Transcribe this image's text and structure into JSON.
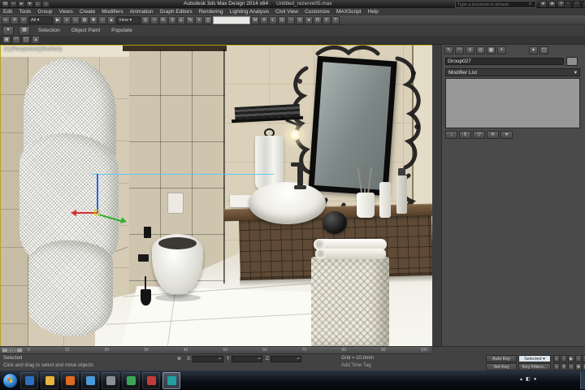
{
  "colors": {
    "viewport_active_border": "#b9a41e",
    "gizmo_x_axis": "#d83030",
    "gizmo_y_axis": "#2faf2f",
    "gizmo_z_axis": "#2e66d8",
    "selection_line": "#5ec6f0"
  },
  "title_bar": {
    "quick_access": [
      {
        "name": "max-logo-icon",
        "glyph": "M"
      },
      {
        "name": "new-file-icon",
        "glyph": "▫"
      },
      {
        "name": "open-file-icon",
        "glyph": "▸"
      },
      {
        "name": "save-file-icon",
        "glyph": "▾"
      },
      {
        "name": "undo-icon",
        "glyph": "←"
      },
      {
        "name": "redo-icon",
        "glyph": "→"
      }
    ],
    "app_title": "Autodesk 3ds Max Design 2014 x64",
    "file_name": "Untitled_rezerve05.max",
    "search_placeholder": "Type a keyword or phrase",
    "info_icons": [
      {
        "name": "search-go-icon",
        "glyph": "▾"
      },
      {
        "name": "communication-center-icon",
        "glyph": "★"
      },
      {
        "name": "help-icon",
        "glyph": "?"
      }
    ],
    "window_controls": [
      {
        "name": "minimize-button",
        "glyph": "–"
      },
      {
        "name": "maximize-button",
        "glyph": "□"
      },
      {
        "name": "close-button",
        "glyph": "✕"
      }
    ]
  },
  "menu_bar": {
    "items": [
      "Edit",
      "Tools",
      "Group",
      "Views",
      "Create",
      "Modifiers",
      "Animation",
      "Graph Editors",
      "Rendering",
      "Lighting Analysis",
      "Civil View",
      "Customize",
      "MAXScript",
      "Help"
    ]
  },
  "toolbar": {
    "items": [
      {
        "name": "select-and-link-icon",
        "cls": "tbi",
        "glyph": "∞"
      },
      {
        "name": "unlink-selection-icon",
        "cls": "tbi",
        "glyph": "≠"
      },
      {
        "name": "bind-to-space-warp-icon",
        "cls": "tbi",
        "glyph": "≈"
      },
      {
        "name": "selection-filter-dropdown",
        "cls": "tbdd",
        "glyph": "All ▾"
      },
      {
        "name": "select-object-icon",
        "cls": "tbi",
        "glyph": "▶"
      },
      {
        "name": "select-by-name-icon",
        "cls": "tbi",
        "glyph": "≡"
      },
      {
        "name": "rectangular-selection-region-icon",
        "cls": "tbi",
        "glyph": "□"
      },
      {
        "name": "window-crossing-icon",
        "cls": "tbi",
        "glyph": "⊠"
      },
      {
        "name": "select-and-move-icon",
        "cls": "tbi",
        "glyph": "✚"
      },
      {
        "name": "select-and-rotate-icon",
        "cls": "tbi",
        "glyph": "○"
      },
      {
        "name": "select-and-scale-icon",
        "cls": "tbi",
        "glyph": "▲"
      },
      {
        "name": "reference-coordinate-system-dropdown",
        "cls": "tbdd",
        "glyph": "View ▾"
      },
      {
        "name": "use-pivot-point-center-icon",
        "cls": "tbi",
        "glyph": "◎"
      },
      {
        "name": "select-and-manipulate-icon",
        "cls": "tbi",
        "glyph": "+"
      },
      {
        "name": "keyboard-shortcut-override-icon",
        "cls": "tbi",
        "glyph": "K"
      },
      {
        "name": "snaps-toggle-icon",
        "cls": "tbi",
        "glyph": "3"
      },
      {
        "name": "angle-snap-icon",
        "cls": "tbi",
        "glyph": "∠"
      },
      {
        "name": "percent-snap-icon",
        "cls": "tbi",
        "glyph": "%"
      },
      {
        "name": "spinner-snap-icon",
        "cls": "tbi",
        "glyph": "±"
      },
      {
        "name": "edit-named-selection-sets-icon",
        "cls": "tbi",
        "glyph": "{}"
      },
      {
        "name": "named-selection-sets-field",
        "cls": "tbbox",
        "glyph": ""
      },
      {
        "name": "mirror-icon",
        "cls": "tbi",
        "glyph": "M"
      },
      {
        "name": "align-icon",
        "cls": "tbi",
        "glyph": "#"
      },
      {
        "name": "layer-manager-icon",
        "cls": "tbi",
        "glyph": "L"
      },
      {
        "name": "graphite-ribbon-toggle-icon",
        "cls": "tbi",
        "glyph": "G"
      },
      {
        "name": "curve-editor-icon",
        "cls": "tbi",
        "glyph": "~"
      },
      {
        "name": "schematic-view-icon",
        "cls": "tbi",
        "glyph": "S"
      },
      {
        "name": "material-editor-icon",
        "cls": "tbi",
        "glyph": "●"
      },
      {
        "name": "render-setup-icon",
        "cls": "tbi",
        "glyph": "R"
      },
      {
        "name": "rendered-frame-window-icon",
        "cls": "tbi",
        "glyph": "F"
      },
      {
        "name": "render-production-icon",
        "cls": "tbi",
        "glyph": "T"
      }
    ]
  },
  "ribbon": {
    "tabs": [
      "Selection",
      "Object Paint",
      "Populate"
    ],
    "sub_tools": [
      {
        "name": "ribbon-polymodeling-icon",
        "glyph": "▦"
      },
      {
        "name": "ribbon-freeform-icon",
        "glyph": "◠"
      },
      {
        "name": "ribbon-selection-tool-icon",
        "glyph": "▢"
      },
      {
        "name": "ribbon-minimize-icon",
        "glyph": "▴"
      }
    ]
  },
  "viewport": {
    "label": "[+] [Perspective] [Realistic]"
  },
  "command_panel": {
    "tabs": [
      {
        "name": "create-tab-icon",
        "cls": "cpt",
        "glyph": "↖"
      },
      {
        "name": "modify-tab-icon",
        "cls": "cpt",
        "glyph": "◠"
      },
      {
        "name": "hierarchy-tab-icon",
        "cls": "cpt",
        "glyph": "≡"
      },
      {
        "name": "motion-tab-icon",
        "cls": "cpt",
        "glyph": "◎"
      },
      {
        "name": "display-tab-icon",
        "cls": "cpt",
        "glyph": "▦"
      },
      {
        "name": "utilities-tab-icon",
        "cls": "cpt",
        "glyph": "+"
      },
      {
        "name": "panel-arrow-icon",
        "cls": "cpt push",
        "glyph": "▾"
      },
      {
        "name": "panel-page-icon",
        "cls": "cpt",
        "glyph": "▢"
      }
    ],
    "object_name": "Group027",
    "object_color_swatch": "#8f8f8f",
    "modifier_list_label": "Modifier List",
    "stack_buttons": [
      {
        "name": "pin-stack-icon",
        "glyph": "↓"
      },
      {
        "name": "show-end-result-icon",
        "glyph": "‖"
      },
      {
        "name": "make-unique-icon",
        "glyph": "▽"
      },
      {
        "name": "remove-modifier-icon",
        "glyph": "✕"
      },
      {
        "name": "configure-modifier-sets-icon",
        "glyph": "▾"
      }
    ]
  },
  "timeline": {
    "slider_label": "0/100",
    "ticks": [
      "0",
      "10",
      "20",
      "30",
      "40",
      "50",
      "60",
      "70",
      "80",
      "90",
      "100"
    ]
  },
  "status_bar": {
    "selected_text": "Selected",
    "prompt": "Click and drag to select and move objects",
    "transform_type_icon": "⊕",
    "coords": [
      {
        "name": "x-coordinate-field",
        "label": "X:",
        "value": ""
      },
      {
        "name": "y-coordinate-field",
        "label": "Y:",
        "value": ""
      },
      {
        "name": "z-coordinate-field",
        "label": "Z:",
        "value": ""
      }
    ],
    "grid_label": "Grid = 10.0mm",
    "add_time_tag": "Add Time Tag",
    "auto_key": "Auto Key",
    "set_key": "Set Key",
    "selected_dropdown": "Selected ▾",
    "key_filters": "Key Filters...",
    "playback": [
      {
        "name": "go-to-start-icon",
        "glyph": "«"
      },
      {
        "name": "previous-frame-icon",
        "glyph": "‹"
      },
      {
        "name": "play-icon",
        "glyph": "▶"
      },
      {
        "name": "next-frame-icon",
        "glyph": "›"
      },
      {
        "name": "go-to-end-icon",
        "glyph": "»"
      }
    ],
    "view_nav": [
      {
        "name": "zoom-icon",
        "glyph": "+"
      },
      {
        "name": "zoom-all-icon",
        "glyph": "#"
      },
      {
        "name": "zoom-extents-icon",
        "glyph": "□"
      },
      {
        "name": "pan-icon",
        "glyph": "✚"
      },
      {
        "name": "maximize-viewport-toggle-icon",
        "glyph": "▢"
      }
    ]
  },
  "taskbar": {
    "apps": [
      {
        "name": "taskbar-app-icon-1",
        "cls": "tb-app",
        "style": "background:#2f6fbf"
      },
      {
        "name": "taskbar-app-icon-2",
        "cls": "tb-app",
        "style": "background:#e8b33d"
      },
      {
        "name": "taskbar-app-icon-3",
        "cls": "tb-app",
        "style": "background:#e06a1f"
      },
      {
        "name": "taskbar-app-icon-4",
        "cls": "tb-app",
        "style": "background:#4a9ad9"
      },
      {
        "name": "taskbar-app-icon-5",
        "cls": "tb-app",
        "style": "background:#8a8f96"
      },
      {
        "name": "taskbar-app-icon-6",
        "cls": "tb-app",
        "style": "background:#3aa655"
      },
      {
        "name": "taskbar-app-icon-7",
        "cls": "tb-app",
        "style": "background:#c23b3b"
      },
      {
        "name": "taskbar-app-icon-8",
        "cls": "tb-app active",
        "style": "background:#20a0a0"
      }
    ],
    "tray": [
      {
        "name": "tray-show-hidden-icon",
        "glyph": "▴"
      },
      {
        "name": "tray-volume-icon",
        "glyph": "◧"
      },
      {
        "name": "tray-network-icon",
        "glyph": "●"
      }
    ]
  }
}
